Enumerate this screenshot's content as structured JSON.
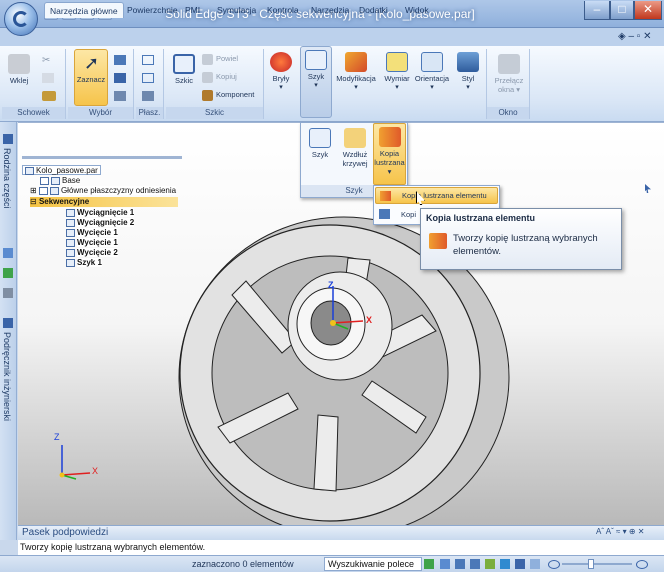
{
  "app": {
    "title": "Solid Edge ST3 - Część sekwencyjna - [Kolo_pasowe.par]"
  },
  "ribbon": {
    "tabs": [
      {
        "label": "Narzędzia główne"
      },
      {
        "label": "Powierzchnie"
      },
      {
        "label": "PMI"
      },
      {
        "label": "Symulacja"
      },
      {
        "label": "Kontrola"
      },
      {
        "label": "Narzędzia"
      },
      {
        "label": "Dodatki"
      },
      {
        "label": "Widok"
      }
    ],
    "groups": {
      "schowek": "Schowek",
      "wybor": "Wybór",
      "plasz": "Płasz.",
      "szkic": "Szkic",
      "okno": "Okno"
    },
    "buttons": {
      "wklej": "Wklej",
      "zaznacz": "Zaznacz",
      "szkic": "Szkic",
      "powiel": "Powiel",
      "kopiuj": "Kopiuj",
      "komponent": "Komponent",
      "bryly": "Bryły",
      "szyk": "Szyk",
      "modyfikacja": "Modyfikacja",
      "wymiar": "Wymiar",
      "orientacja": "Orientacja",
      "styl": "Styl",
      "przelacz": "Przełącz",
      "okna": "okna"
    }
  },
  "szyk_dropdown": {
    "szyk": "Szyk",
    "wzdluz1": "Wzdłuż",
    "wzdluz2": "krzywej",
    "kopia1": "Kopia",
    "kopia2": "lustrzana",
    "footer": "Szyk"
  },
  "menu": {
    "item1": "Kopia lustrzana elementu",
    "item2": "Kopi"
  },
  "tooltip": {
    "title": "Kopia lustrzana elementu",
    "text1": "Tworzy kopię lustrzaną wybranych",
    "text2": "elementów."
  },
  "left_tabs": {
    "rodzina": "Rodzina części",
    "podrecznik": "Podręcznik inżynierski"
  },
  "tree": {
    "root": "Kolo_pasowe.par",
    "base": "Base",
    "planes": "Główne płaszczyzny odniesienia",
    "seq": "Sekwencyjne",
    "items": [
      "Wyciągnięcie 1",
      "Wyciągnięcie 2",
      "Wycięcie 1",
      "Wycięcie 1",
      "Wycięcie 2",
      "Szyk 1"
    ]
  },
  "axes": {
    "z": "Z",
    "x": "X"
  },
  "hint_panel": {
    "title": "Pasek podpowiedzi",
    "text": "Tworzy kopię lustrzaną wybranych elementów.",
    "controls": "Aˆ Aˇ ≈ ▾ ⊕ ✕"
  },
  "status": {
    "selected": "zaznaczono 0 elementów",
    "search": "Wyszukiwanie polece"
  },
  "colors": {
    "accent": "#f5c342",
    "ribbon_bg": "#dbe7f6"
  }
}
